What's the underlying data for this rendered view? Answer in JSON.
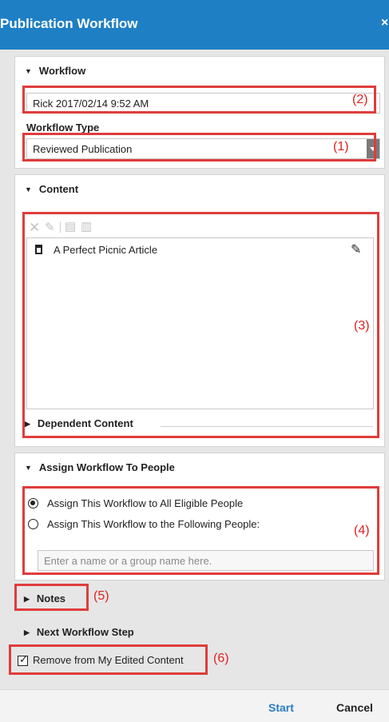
{
  "dialog": {
    "title": "Publication Workflow",
    "close_label": "×"
  },
  "workflow_section": {
    "heading": "Workflow",
    "name_value": "Rick 2017/02/14 9:52 AM",
    "type_label": "Workflow Type",
    "type_value": "Reviewed Publication"
  },
  "content_section": {
    "heading": "Content",
    "items": [
      {
        "title": "A Perfect Picnic Article",
        "icon": "document-icon"
      }
    ],
    "dependent_heading": "Dependent Content"
  },
  "assign_section": {
    "heading": "Assign Workflow To People",
    "option_all": "Assign This Workflow to All Eligible People",
    "option_following": "Assign This Workflow to the Following People:",
    "people_placeholder": "Enter a name or a group name here.",
    "selected": "all"
  },
  "notes": {
    "heading": "Notes"
  },
  "next_step": {
    "heading": "Next Workflow Step"
  },
  "remove_option": {
    "label": "Remove from My Edited Content",
    "checked": true
  },
  "footer": {
    "start_label": "Start",
    "cancel_label": "Cancel"
  },
  "annotations": {
    "a1": "(1)",
    "a2": "(2)",
    "a3": "(3)",
    "a4": "(4)",
    "a5": "(5)",
    "a6": "(6)"
  },
  "colors": {
    "title_bar": "#1f7fc4",
    "annotation": "#e03c3c",
    "start_button": "#2b7bc4"
  }
}
